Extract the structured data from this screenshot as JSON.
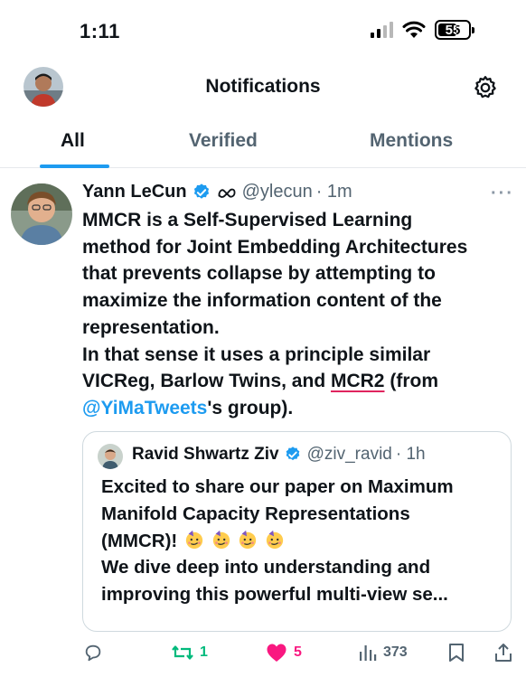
{
  "status_bar": {
    "time": "1:11",
    "battery": "55"
  },
  "header": {
    "title": "Notifications"
  },
  "tabs": [
    {
      "label": "All",
      "active": true
    },
    {
      "label": "Verified",
      "active": false
    },
    {
      "label": "Mentions",
      "active": false
    }
  ],
  "tweet": {
    "author": "Yann LeCun",
    "handle": "@ylecun",
    "time": "· 1m",
    "body_lines": [
      "MMCR is a Self-Supervised Learning",
      "method for Joint Embedding Architectures",
      "that prevents collapse by attempting to",
      "maximize the information content of the",
      "representation.",
      "In that sense it uses a principle similar",
      "VICReg, Barlow Twins, and "
    ],
    "body_highlight": "MCR2",
    "body_line7_tail": " (from",
    "body_mention": "@YiMaTweets",
    "body_last_tail": "'s group).",
    "quote": {
      "author": "Ravid Shwartz Ziv",
      "handle": "@ziv_ravid",
      "time": "· 1h",
      "lines": [
        "Excited to share our paper on Maximum",
        "Manifold Capacity Representations",
        "(MMCR)!",
        "We dive deep into understanding and",
        "improving this powerful multi-view se..."
      ],
      "emoji": "partying-face-emoji"
    },
    "stats": {
      "retweets": "1",
      "likes": "5",
      "views": "373"
    }
  },
  "colors": {
    "accent": "#1d9bf0",
    "like": "#f91880",
    "retweet": "#00ba7c",
    "underline": "#e0245e",
    "muted": "#536471"
  },
  "icons": [
    "signal-icon",
    "wifi-icon",
    "battery-icon",
    "gear-icon",
    "verified-badge-icon",
    "meta-logo-icon",
    "more-icon",
    "reply-icon",
    "retweet-icon",
    "like-icon",
    "views-icon",
    "bookmark-icon",
    "share-icon"
  ]
}
